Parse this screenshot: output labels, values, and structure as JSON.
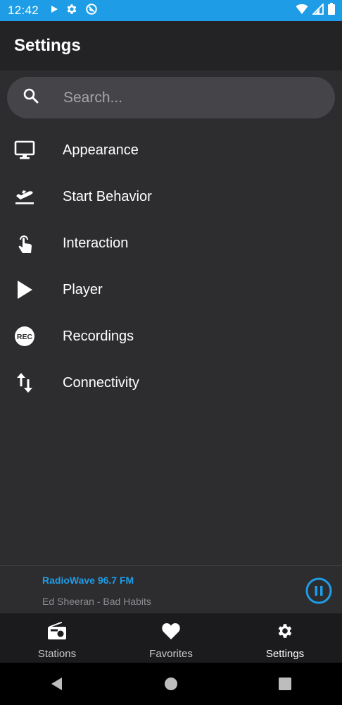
{
  "status_bar": {
    "time": "12:42",
    "left_icons": [
      "play-icon",
      "gear-icon",
      "data-saver-icon"
    ],
    "right_icons": [
      "wifi-icon",
      "signal-icon",
      "battery-icon"
    ]
  },
  "app_bar": {
    "title": "Settings"
  },
  "search": {
    "placeholder": "Search..."
  },
  "menu": {
    "items": [
      {
        "label": "Appearance",
        "icon": "monitor-icon"
      },
      {
        "label": "Start Behavior",
        "icon": "flight-takeoff-icon"
      },
      {
        "label": "Interaction",
        "icon": "touch-icon"
      },
      {
        "label": "Player",
        "icon": "play-icon"
      },
      {
        "label": "Recordings",
        "icon": "rec-icon"
      },
      {
        "label": "Connectivity",
        "icon": "swap-vertical-icon"
      }
    ]
  },
  "player": {
    "station": "RadioWave 96.7 FM",
    "track": "Ed Sheeran - Bad Habits",
    "control": "pause-icon"
  },
  "bottom_nav": {
    "tabs": [
      {
        "label": "Stations",
        "icon": "radio-icon"
      },
      {
        "label": "Favorites",
        "icon": "heart-icon"
      },
      {
        "label": "Settings",
        "icon": "gear-icon",
        "active": true
      }
    ]
  },
  "colors": {
    "accent": "#1e9de6",
    "background": "#2d2c2f",
    "app_bar": "#232225",
    "search_field": "#454449",
    "bottom_nav": "#1b1a1d"
  }
}
